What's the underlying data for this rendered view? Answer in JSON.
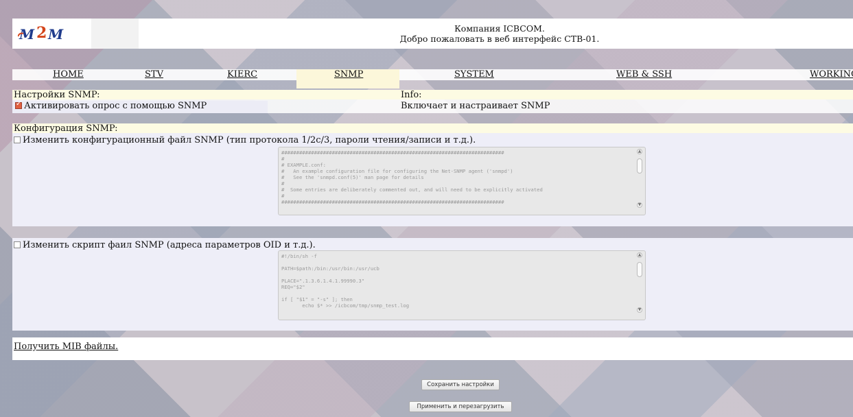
{
  "header": {
    "company": "Компания ICBCOM.",
    "welcome": "Добро пожаловать в веб интерфейс СТВ-01."
  },
  "nav": {
    "tabs": [
      {
        "label": "HOME"
      },
      {
        "label": "STV"
      },
      {
        "label": "KIERC"
      },
      {
        "label": "SNMP"
      },
      {
        "label": "SYSTEM"
      },
      {
        "label": "WEB & SSH"
      },
      {
        "label": "WORKING"
      }
    ],
    "active": "SNMP"
  },
  "snmp_settings": {
    "section_title": "Настройки SNMP:",
    "info_label": "Info:",
    "activate_label": "Активировать опрос с помощью SNMP",
    "activate_checked": true,
    "info_text": "Включает и настраивает SNMP"
  },
  "snmp_config": {
    "section_title": "Конфигурация SNMP:",
    "edit_conf_label": "Изменить конфигурационный файл SNMP (тип протокола 1/2c/3, пароли чтения/записи и т.д.).",
    "edit_conf_checked": false,
    "conf_text": "###########################################################################\n#\n# EXAMPLE.conf:\n#   An example configuration file for configuring the Net-SNMP agent ('snmpd')\n#   See the 'snmpd.conf(5)' man page for details\n#\n#  Some entries are deliberately commented out, and will need to be explicitly activated\n#\n###########################################################################",
    "edit_script_label": "Изменить скрипт фаил SNMP (адреса параметров OID и т.д.).",
    "edit_script_checked": false,
    "script_text": "#!/bin/sh -f\n\nPATH=$path:/bin:/usr/bin:/usr/ucb\n\nPLACE=\".1.3.6.1.4.1.99990.3\"\nREQ=\"$2\"\n\nif [ \"$1\" = \"-s\" ]; then\n       echo $* >> /icbcom/tmp/snmp_test.log"
  },
  "mib_link": "Получить MIB файлы.",
  "buttons": {
    "save": "Сохранить настройки",
    "apply_reboot": "Применить и перезагрузить"
  },
  "colors": {
    "active_tab": "#fcf7da",
    "section_yellow": "#fdfbe3",
    "panel": "#eeeef8",
    "checkbox_on": "#e06040"
  }
}
